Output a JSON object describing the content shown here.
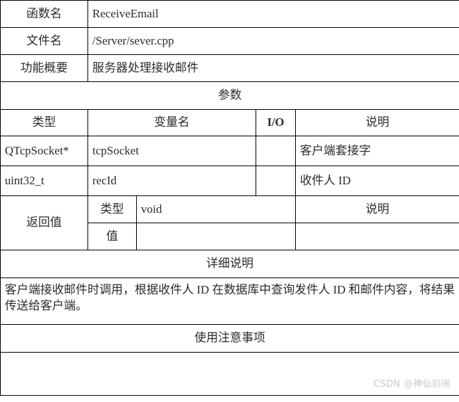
{
  "colors": {
    "header_shade": "#dce6f1",
    "border": "#000000",
    "text": "#2b2b2b",
    "watermark": "#c7c7c7"
  },
  "spec": {
    "function_name_label": "函数名",
    "function_name_value": "ReceiveEmail",
    "file_name_label": "文件名",
    "file_name_value": "/Server/sever.cpp",
    "summary_label": "功能概要",
    "summary_value": "服务器处理接收邮件",
    "parameters_band": "参数",
    "param_headers": {
      "type": "类型",
      "variable": "变量名",
      "io": "I/O",
      "description": "说明"
    },
    "parameters": [
      {
        "type": "QTcpSocket*",
        "variable": "tcpSocket",
        "io": "",
        "description": "客户端套接字"
      },
      {
        "type": "uint32_t",
        "variable": "recId",
        "io": "",
        "description": "收件人 ID"
      }
    ],
    "return_label": "返回值",
    "return_type_label": "类型",
    "return_type_value": "void",
    "return_desc_header": "说明",
    "return_desc_value": "",
    "return_value_label": "值",
    "return_value_value": "",
    "detail_band": "详细说明",
    "detail_text": "客户端接收邮件时调用，根据收件人 ID 在数据库中查询发件人 ID 和邮件内容，将结果传送给客户端。",
    "notes_band": "使用注意事项",
    "notes_text": ""
  },
  "watermark": {
    "text": "CSDN @神仙别闹"
  }
}
